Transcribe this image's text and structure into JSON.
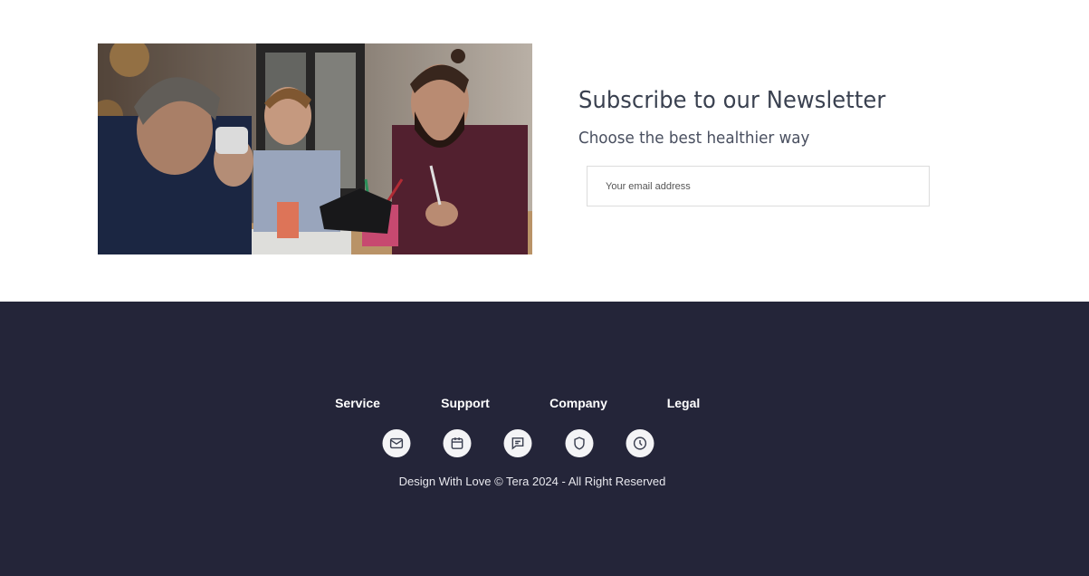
{
  "newsletter": {
    "title": "Subscribe to our Newsletter",
    "subtitle": "Choose the best healthier way",
    "email_placeholder": "Your email address"
  },
  "footer": {
    "links": [
      {
        "label": "Service"
      },
      {
        "label": "Support"
      },
      {
        "label": "Company"
      },
      {
        "label": "Legal"
      }
    ],
    "icons": [
      "mail-icon",
      "calendar-icon",
      "chat-icon",
      "shield-icon",
      "clock-icon"
    ],
    "copyright": "Design With Love © Tera 2024 - All Right Reserved"
  },
  "colors": {
    "footer_bg": "#242539",
    "heading": "#3a4150",
    "icon_bg": "#f4f4f6"
  }
}
